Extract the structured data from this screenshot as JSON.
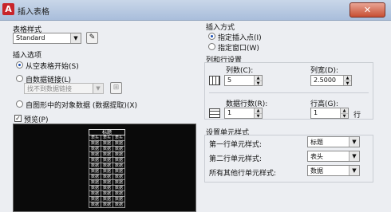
{
  "window": {
    "title": "插入表格",
    "app_icon": "A",
    "close": "✕"
  },
  "table_style": {
    "label": "表格样式",
    "value": "Standard"
  },
  "insert_options": {
    "label": "插入选项",
    "opt_empty": "从空表格开始(S)",
    "opt_link": "自数据链接(L)",
    "link_placeholder": "找不到数据链接",
    "opt_extract": "自图形中的对象数据 (数据提取)(X)"
  },
  "preview": {
    "label": "预览(P)",
    "checked": true,
    "table_header": "标题",
    "header_cells": [
      "表头",
      "表头",
      "表头"
    ],
    "data_cell": "数据"
  },
  "insert_method": {
    "label": "插入方式",
    "opt_point": "指定插入点(I)",
    "opt_window": "指定窗口(W)"
  },
  "rowcol": {
    "label": "列和行设置",
    "columns_label": "列数(C):",
    "columns_value": "5",
    "colwidth_label": "列宽(D):",
    "colwidth_value": "2.5000",
    "datarows_label": "数据行数(R):",
    "datarows_value": "1",
    "rowheight_label": "行高(G):",
    "rowheight_value": "1",
    "rowheight_unit": "行"
  },
  "cell_style": {
    "label": "设置单元样式",
    "row1_label": "第一行单元样式:",
    "row1_value": "标题",
    "row2_label": "第二行单元样式:",
    "row2_value": "表头",
    "other_label": "所有其他行单元样式:",
    "other_value": "数据"
  }
}
